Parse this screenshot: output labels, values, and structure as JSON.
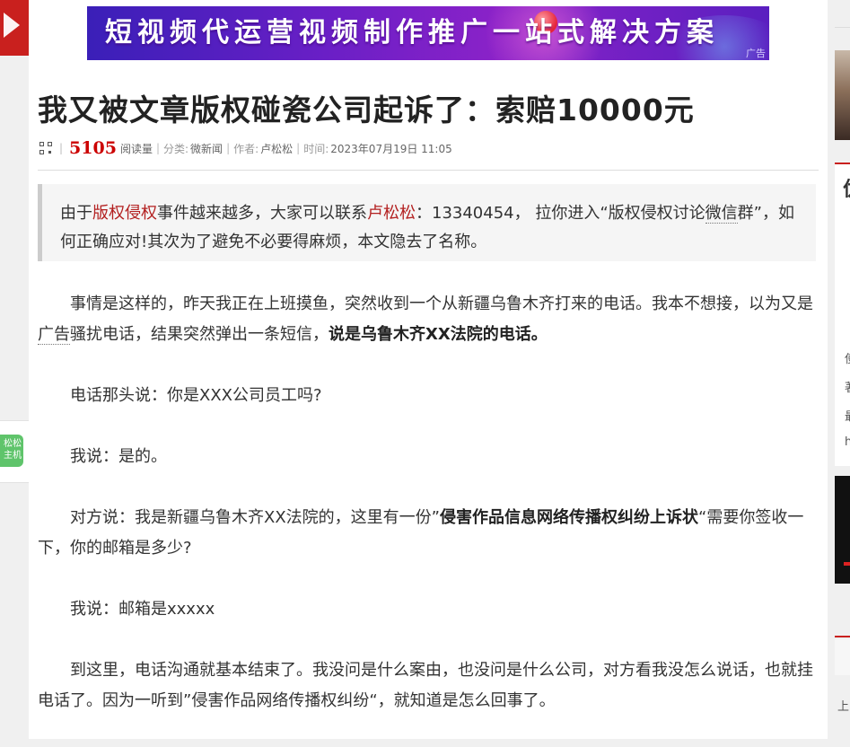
{
  "banner": {
    "text": "短视频代运营视频制作推广一站式解决方案",
    "ad_tag": "广告"
  },
  "left": {
    "promo_lines": [
      "松松",
      "主机"
    ]
  },
  "article": {
    "title": "我又被文章版权碰瓷公司起诉了：索赔10000元",
    "meta": {
      "read_count": "5105",
      "read_label": "阅读量",
      "category_label": "分类:",
      "category": "微新闻",
      "author_label": "作者:",
      "author": "卢松松",
      "time_label": "时间:",
      "time": "2023年07月19日 11:05"
    },
    "notice": {
      "p1": "由于",
      "link1": "版权侵权",
      "p2": "事件越来越多，大家可以联系",
      "link2": "卢松松",
      "p3": "：13340454， 拉你进入“版权侵权讨论",
      "link3": "微信",
      "p4": "群”，如何正确应对!其次为了避免不必要得麻烦，本文隐去了名称。"
    },
    "paragraphs": {
      "p1_a": "事情是这样的，昨天我正在上班摸鱼，突然收到一个从新疆乌鲁木齐打来的电话。我本不想接，以为又是",
      "p1_link": "广告",
      "p1_b": "骚扰电话，结果突然弹出一条短信，",
      "p1_bold": "说是乌鲁木齐XX法院的电话。",
      "p2": "电话那头说：你是XXX公司员工吗?",
      "p3": "我说：是的。",
      "p4_a": "对方说：我是新疆乌鲁木齐XX法院的，这里有一份”",
      "p4_bold": "侵害作品信息网络传播权纠纷上诉状",
      "p4_b": "“需要你签收一下，你的邮箱是多少?",
      "p5": "我说：邮箱是xxxxx",
      "p6": "到这里，电话沟通就基本结束了。我没问是什么案由，也没问是什么公司，对方看我没怎么说话，也就挂电话了。因为一听到”侵害作品网络传播权纠纷“，就知道是怎么回事了。"
    }
  },
  "sidebar": {
    "card_title_fragment": "优",
    "card_glyphs": [
      "使",
      "著",
      "最",
      "h"
    ],
    "bottom_fragment": "上"
  },
  "colors": {
    "accent_red": "#c9201e",
    "link_red": "#b32020",
    "count_red": "#cc0000"
  },
  "icons": {
    "qr": "qr-code-icon",
    "left_arrow": "arrow-icon"
  }
}
